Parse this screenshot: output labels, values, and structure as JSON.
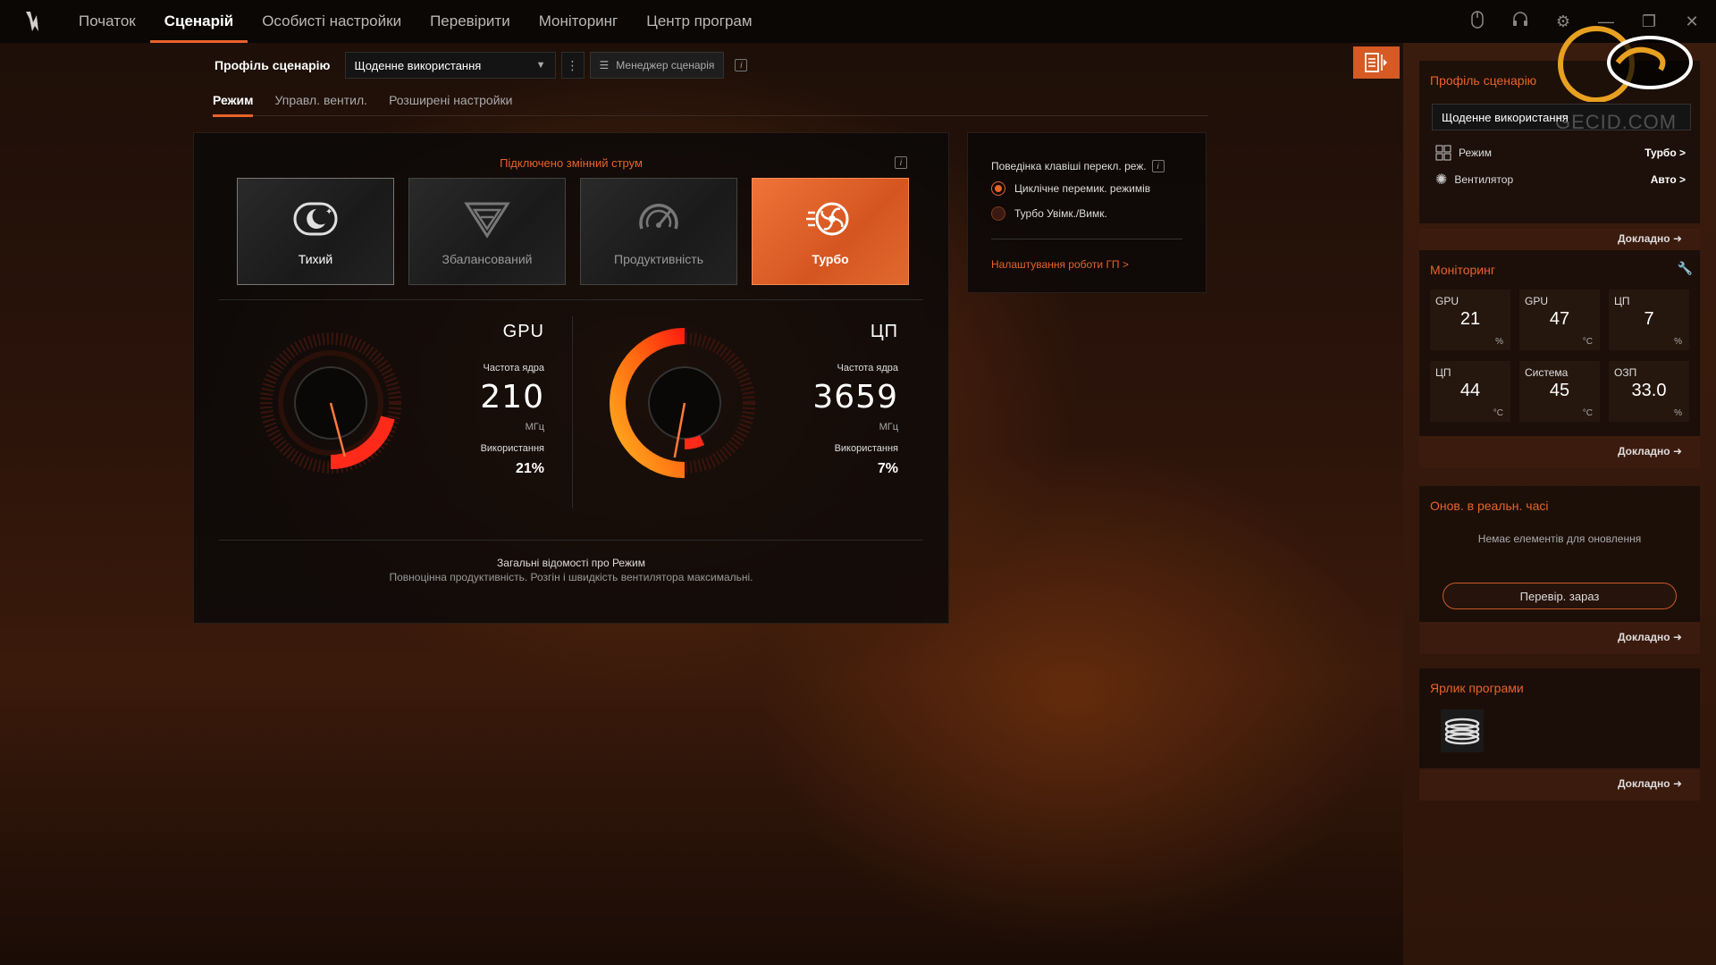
{
  "nav": {
    "items": [
      {
        "label": "Початок"
      },
      {
        "label": "Сценарій"
      },
      {
        "label": "Особисті настройки"
      },
      {
        "label": "Перевірити"
      },
      {
        "label": "Моніторинг"
      },
      {
        "label": "Центр програм"
      }
    ]
  },
  "profile": {
    "label": "Профіль сценарію",
    "selected": "Щоденне використання",
    "manager_label": "Менеджер сценарія"
  },
  "subtabs": [
    {
      "label": "Режим"
    },
    {
      "label": "Управл. вентил."
    },
    {
      "label": "Розширені настройки"
    }
  ],
  "power_status": "Підключено змінний струм",
  "modes": [
    {
      "label": "Тихий",
      "icon": "moon-icon"
    },
    {
      "label": "Збалансований",
      "icon": "balance-icon"
    },
    {
      "label": "Продуктивність",
      "icon": "speedometer-icon"
    },
    {
      "label": "Турбо",
      "icon": "turbo-fan-icon"
    }
  ],
  "gpu": {
    "title": "GPU",
    "clock_label": "Частота ядра",
    "clock_value": "210",
    "clock_unit": "МГц",
    "usage_label": "Використання",
    "usage_value": "21%",
    "usage_fraction": 0.21
  },
  "cpu": {
    "title": "ЦП",
    "clock_label": "Частота ядра",
    "clock_value": "3659",
    "clock_unit": "МГц",
    "usage_label": "Використання",
    "usage_value": "7%",
    "usage_fraction": 0.07
  },
  "mode_info": {
    "title": "Загальні відомості про Режим",
    "desc": "Повноцінна продуктивність. Розгін і швидкість вентилятора максимальні."
  },
  "key_behavior": {
    "title": "Поведінка клавіші перекл. реж.",
    "options": [
      {
        "label": "Циклічне перемик. режимів"
      },
      {
        "label": "Турбо Увімк./Вимк."
      }
    ],
    "gpu_link": "Налаштування роботи ГП >"
  },
  "sidebar": {
    "profile": {
      "title": "Профіль сценарію",
      "selected": "Щоденне використання",
      "rows": [
        {
          "label": "Режим",
          "value": "Турбо >"
        },
        {
          "label": "Вентилятор",
          "value": "Авто >"
        }
      ],
      "more": "Докладно"
    },
    "monitoring": {
      "title": "Моніторинг",
      "tiles": [
        {
          "name": "GPU",
          "value": "21",
          "unit": "%"
        },
        {
          "name": "GPU",
          "value": "47",
          "unit": "°C"
        },
        {
          "name": "ЦП",
          "value": "7",
          "unit": "%"
        },
        {
          "name": "ЦП",
          "value": "44",
          "unit": "°C"
        },
        {
          "name": "Система",
          "value": "45",
          "unit": "°C"
        },
        {
          "name": "ОЗП",
          "value": "33.0",
          "unit": "%"
        }
      ],
      "more": "Докладно"
    },
    "updates": {
      "title": "Онов. в реальн. часі",
      "empty": "Немає елементів для оновлення",
      "button": "Перевір. зараз",
      "more": "Докладно"
    },
    "shortcut": {
      "title": "Ярлик програми",
      "more": "Докладно"
    }
  },
  "watermark": {
    "text": "GECID.COM"
  },
  "colors": {
    "accent": "#e8622a",
    "turbo_tile": "#d55520"
  }
}
